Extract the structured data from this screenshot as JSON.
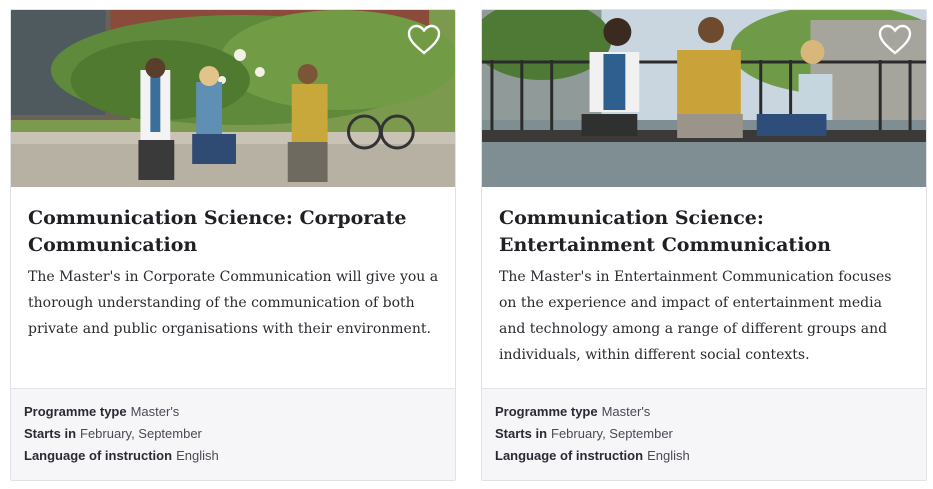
{
  "cards": [
    {
      "title": "Communication Science: Corporate Communication",
      "description": "The Master's in Corporate Communication will give you a thorough understanding of the communication of both private and public organisations with their environment.",
      "favorite_icon": "heart-outline-icon",
      "meta": [
        {
          "label": "Programme type",
          "value": "Master's"
        },
        {
          "label": "Starts in",
          "value": "February, September"
        },
        {
          "label": "Language of instruction",
          "value": "English"
        }
      ]
    },
    {
      "title": "Communication Science: Entertainment Communication",
      "description": "The Master's in Entertainment Communication focuses on the experience and impact of entertainment media and technology among a range of different groups and individuals, within different social contexts.",
      "favorite_icon": "heart-outline-icon",
      "meta": [
        {
          "label": "Programme type",
          "value": "Master's"
        },
        {
          "label": "Starts in",
          "value": "February, September"
        },
        {
          "label": "Language of instruction",
          "value": "English"
        }
      ]
    }
  ],
  "colors": {
    "title": "#1f1f24",
    "meta_bg": "#f6f6f8",
    "border": "#e2e2e6"
  }
}
